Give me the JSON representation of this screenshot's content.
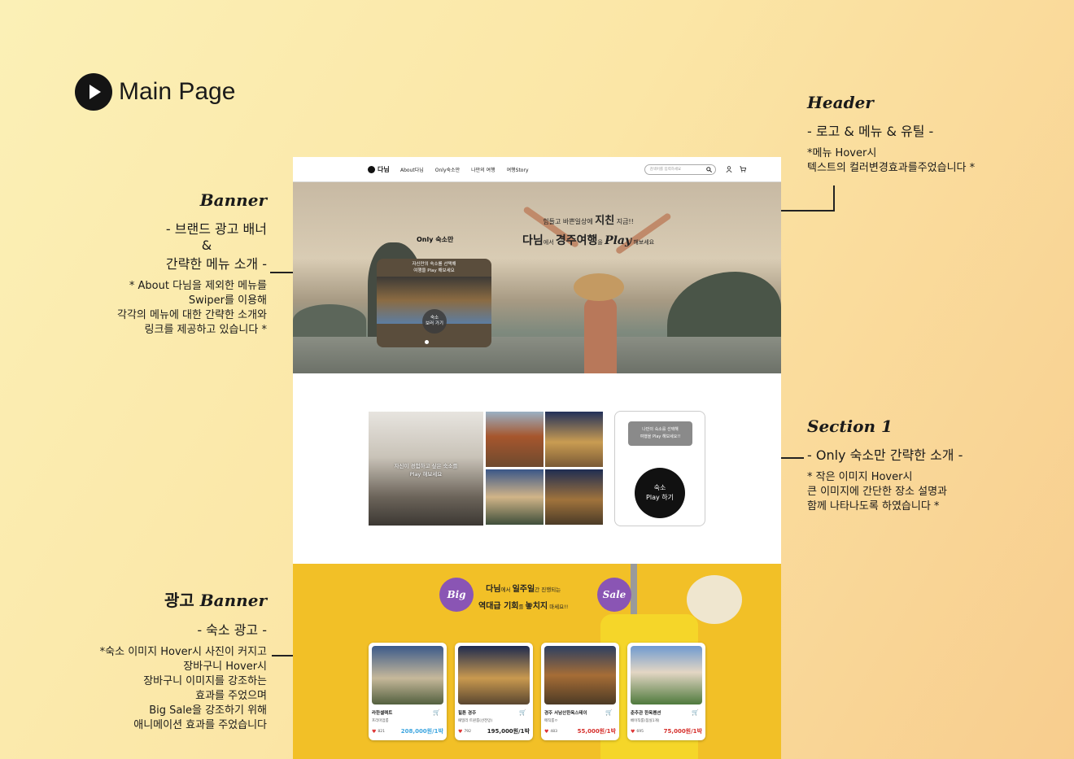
{
  "page_title": "Main Page",
  "colors": {
    "accent_purple": "#8a55b4",
    "ad_yellow": "#f2c027",
    "price_blue": "#3ea6e0",
    "price_red": "#d6302c"
  },
  "annotations": {
    "header": {
      "script_title": "Header",
      "heading": "- 로고 & 메뉴 & 유틸 -",
      "line1": "*메뉴 Hover시",
      "line2": "텍스트의 컬러변경효과를주었습니다 *"
    },
    "banner": {
      "script_title": "Banner",
      "heading1": "- 브랜드 광고 배너",
      "heading2": "&",
      "heading3": "간략한 메뉴 소개 -",
      "line1": "* About 다님을 제외한 메뉴를",
      "line2": "Swiper를 이용해",
      "line3": "각각의 메뉴에 대한 간략한 소개와",
      "line4": "링크를 제공하고 있습니다 *"
    },
    "section1": {
      "script_title": "Section 1",
      "heading": "- Only 숙소만 간략한 소개 -",
      "line1": "* 작은 이미지 Hover시",
      "line2": "큰 이미지에 간단한 장소 설명과",
      "line3": "함께 나타나도록 하였습니다 *"
    },
    "ad": {
      "title_kr": "광고",
      "script_title": "Banner",
      "heading": "- 숙소 광고 -",
      "line1": "*숙소 이미지 Hover시 사진이 커지고",
      "line2": "장바구니 Hover시",
      "line3": "장바구니 이미지를 강조하는",
      "line4": "효과를 주었으며",
      "line5": "Big Sale을 강조하기 위해",
      "line6": "애니메이션 효과를 주었습니다"
    }
  },
  "mock": {
    "header": {
      "logo": "다님",
      "nav": [
        "About다님",
        "Only숙소만",
        "나만의 여행",
        "여행Story"
      ],
      "search_placeholder": "검색어를 입력하세요",
      "icons": [
        "search-icon",
        "user-icon",
        "cart-icon"
      ]
    },
    "banner": {
      "line1_pre": "힘들고 바쁜일상에 ",
      "line1_big": "지친",
      "line1_post": " 지금!!",
      "line2_a": "다님",
      "line2_b": "에서 ",
      "line2_c": "경주여행",
      "line2_d": "을 ",
      "line2_e": "Play",
      "line2_f": " 해보세요",
      "card_title": "Only 숙소만",
      "card_cap1": "자신만의 숙소를 선택해",
      "card_cap2": "여행을 Play 해보세요",
      "card_btn1": "숙소",
      "card_btn2": "보러 가기"
    },
    "section1": {
      "big_cap1": "자신이 경험하고 싶은 숙소를",
      "big_cap2": "Play 해보세요",
      "side_tag1": "나만의 숙소를 선택해",
      "side_tag2": "여행을 Play 해보세요!!",
      "play1": "숙소",
      "play2": "Play 하기"
    },
    "ad": {
      "badge_left": "Big",
      "badge_right": "Sale",
      "l1_a": "다님",
      "l1_b": "에서 ",
      "l1_c": "일주일",
      "l1_d": "간 진행되는",
      "l2_a": "역대급 기회",
      "l2_b": "를 ",
      "l2_c": "놓치지",
      "l2_d": " 마세요!!",
      "cards": [
        {
          "name": "라한셀렉트",
          "loc": "프리미엄룸",
          "likes": "821",
          "price": "208,000원/1박",
          "price_color": "#3ea6e0"
        },
        {
          "name": "힐튼 경주",
          "loc": "패밀리 트윈룸(산전망)",
          "likes": "792",
          "price": "195,000원/1박",
          "price_color": "#222222"
        },
        {
          "name": "경주 서남산한옥스테이",
          "loc": "매직룸ㅇ",
          "likes": "483",
          "price": "55,000원/1박",
          "price_color": "#d6302c"
        },
        {
          "name": "춘추관 한옥펜션",
          "loc": "베이직룸(침실1개)",
          "likes": "695",
          "price": "75,000원/1박",
          "price_color": "#d6302c"
        }
      ]
    }
  }
}
